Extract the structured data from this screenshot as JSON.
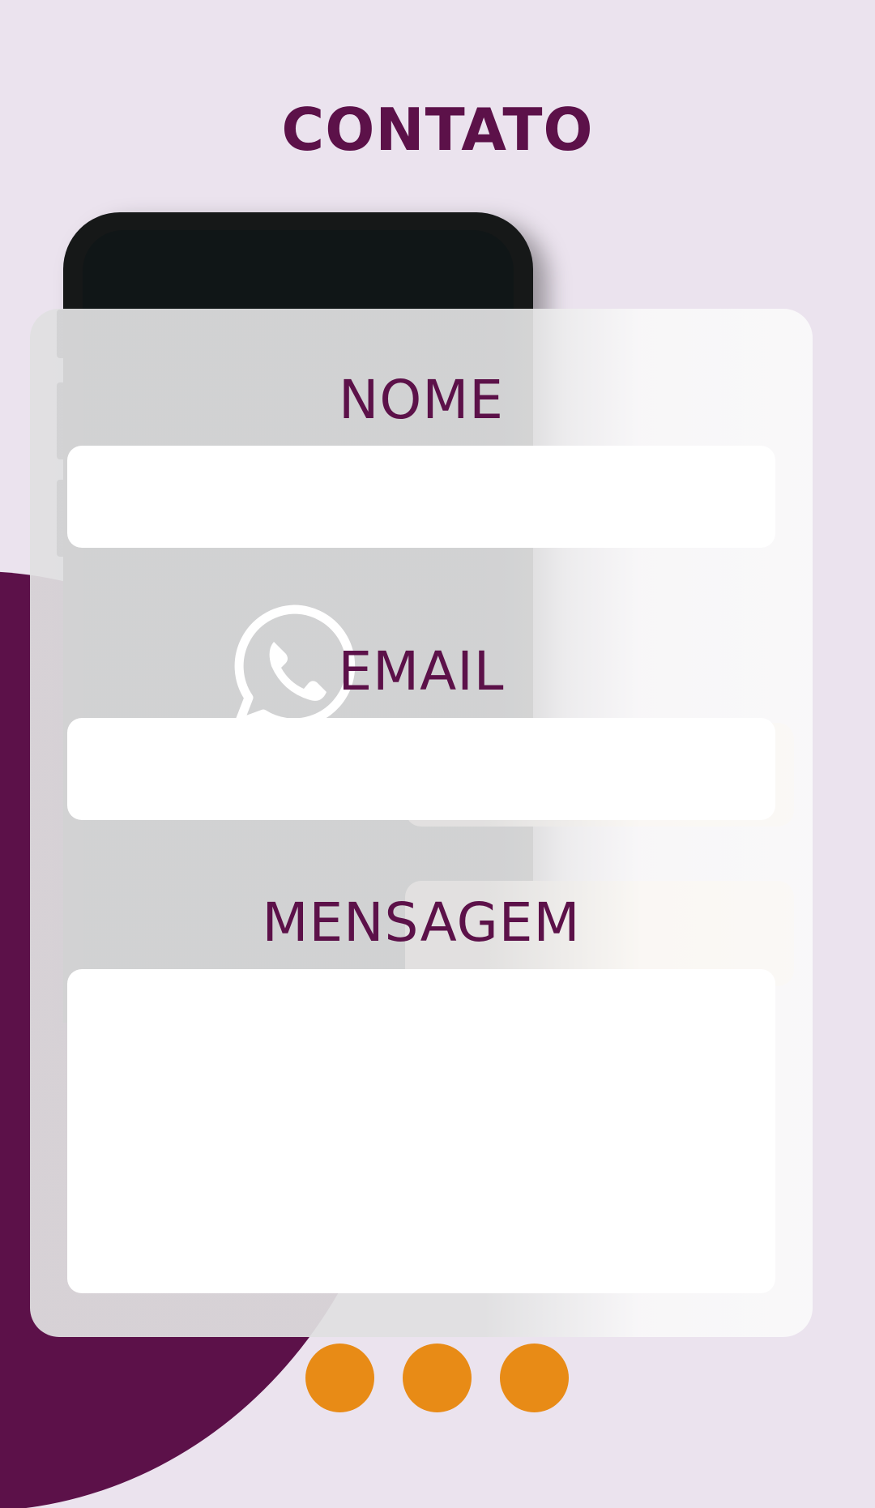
{
  "page": {
    "title": "CONTATO"
  },
  "form": {
    "name_label": "NOME",
    "name_value": "",
    "email_label": "EMAIL",
    "email_value": "",
    "message_label": "MENSAGEM",
    "message_value": ""
  },
  "pagination": {
    "dots": 3
  },
  "colors": {
    "background": "#ebe3ee",
    "brand_purple": "#5c1149",
    "accent_orange": "#e88b16",
    "card": "#e0e0e1",
    "input": "#ffffff"
  },
  "icons": {
    "background_icon": "whatsapp-icon"
  }
}
